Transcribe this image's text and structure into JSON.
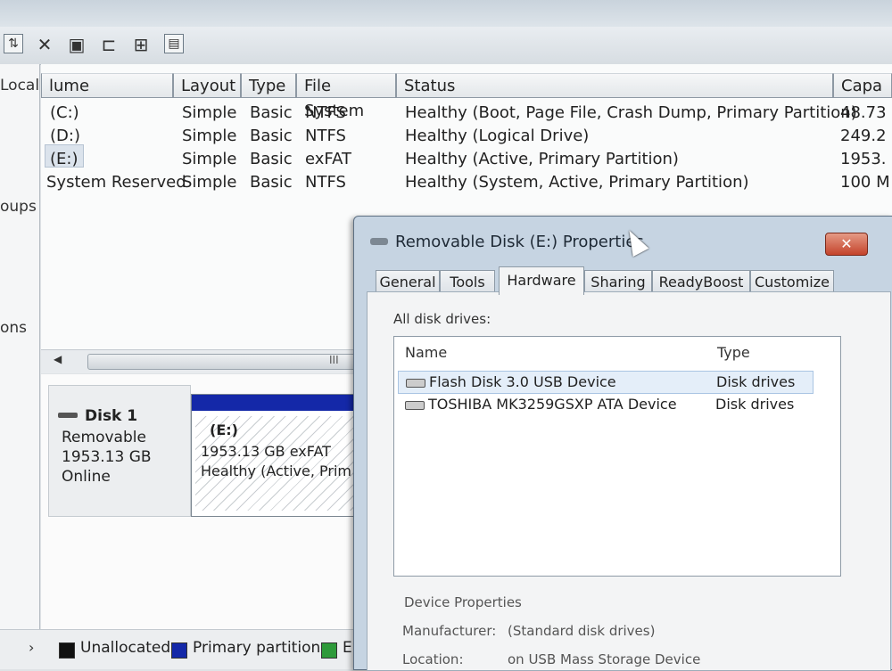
{
  "toolbar": {
    "icons": [
      "refresh-icon",
      "delete-icon",
      "properties-icon",
      "open-folder-icon",
      "help-icon",
      "rescan-icon"
    ]
  },
  "leftnav": {
    "items": [
      "Local",
      "oups",
      "ons"
    ]
  },
  "volume_table": {
    "headers": [
      "lume",
      "Layout",
      "Type",
      "File System",
      "Status",
      "Capa"
    ],
    "rows": [
      {
        "volume": "(C:)",
        "layout": "Simple",
        "type": "Basic",
        "fs": "NTFS",
        "status": "Healthy (Boot, Page File, Crash Dump, Primary Partition)",
        "capacity": "48.73"
      },
      {
        "volume": "(D:)",
        "layout": "Simple",
        "type": "Basic",
        "fs": "NTFS",
        "status": "Healthy (Logical Drive)",
        "capacity": "249.2"
      },
      {
        "volume": "(E:)",
        "layout": "Simple",
        "type": "Basic",
        "fs": "exFAT",
        "status": "Healthy (Active, Primary Partition)",
        "capacity": "1953."
      },
      {
        "volume": "System Reserved",
        "layout": "Simple",
        "type": "Basic",
        "fs": "NTFS",
        "status": "Healthy (System, Active, Primary Partition)",
        "capacity": "100 M"
      }
    ]
  },
  "scrollbar": {
    "grip": "III",
    "left_arrow": "◀"
  },
  "disk": {
    "name": "Disk 1",
    "kind": "Removable",
    "size": "1953.13 GB",
    "state": "Online",
    "partition": {
      "label": "(E:)",
      "detail": "1953.13 GB exFAT",
      "status": "Healthy (Active, Prim"
    }
  },
  "legend": {
    "items": [
      {
        "label": "Unallocated",
        "color": "#111111"
      },
      {
        "label": "Primary partition",
        "color": "#1428a8"
      },
      {
        "label": "E",
        "color": "#2e9a3a"
      }
    ],
    "arrow": "›"
  },
  "dialog": {
    "title": "Removable Disk (E:) Properties",
    "close": "✕",
    "tabs": [
      "General",
      "Tools",
      "Hardware",
      "Sharing",
      "ReadyBoost",
      "Customize"
    ],
    "active_tab": "Hardware",
    "section_label": "All disk drives:",
    "list_headers": [
      "Name",
      "Type"
    ],
    "drives": [
      {
        "name": "Flash Disk 3.0 USB Device",
        "type": "Disk drives"
      },
      {
        "name": "TOSHIBA MK3259GSXP ATA Device",
        "type": "Disk drives"
      }
    ],
    "device_properties": {
      "heading": "Device Properties",
      "manufacturer_label": "Manufacturer:",
      "manufacturer_value": "(Standard disk drives)",
      "location_label": "Location:",
      "location_value": "on USB Mass Storage Device"
    }
  }
}
